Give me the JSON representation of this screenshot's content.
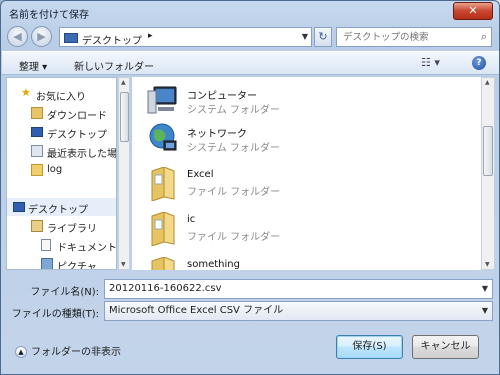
{
  "window": {
    "title": "名前を付けて保存",
    "close_symbol": "✕"
  },
  "address": {
    "location": "デスクトップ",
    "separator": "▸"
  },
  "search": {
    "placeholder": "デスクトップの検索"
  },
  "toolbar": {
    "organize": "整理 ▾",
    "new_folder": "新しいフォルダー"
  },
  "sidebar": {
    "items": [
      {
        "label": "お気に入り",
        "icon": "star-icon"
      },
      {
        "label": "ダウンロード",
        "icon": "download-folder-icon"
      },
      {
        "label": "デスクトップ",
        "icon": "desktop-icon"
      },
      {
        "label": "最近表示した場所",
        "icon": "recent-places-icon"
      },
      {
        "label": "log",
        "icon": "folder-icon"
      },
      {
        "label": "デスクトップ",
        "icon": "desktop-icon",
        "selected": true
      },
      {
        "label": "ライブラリ",
        "icon": "library-icon"
      },
      {
        "label": "ドキュメント",
        "icon": "documents-icon"
      },
      {
        "label": "ピクチャ",
        "icon": "pictures-icon"
      }
    ]
  },
  "files": [
    {
      "name": "コンピューター",
      "type": "システム フォルダー",
      "icon": "computer-icon"
    },
    {
      "name": "ネットワーク",
      "type": "システム フォルダー",
      "icon": "network-globe-icon"
    },
    {
      "name": "Excel",
      "type": "ファイル フォルダー",
      "icon": "folder-icon"
    },
    {
      "name": "ic",
      "type": "ファイル フォルダー",
      "icon": "folder-icon"
    },
    {
      "name": "something",
      "type": "",
      "icon": "folder-icon"
    }
  ],
  "form": {
    "filename_label": "ファイル名(N):",
    "filename_value": "20120116-160622.csv",
    "filetype_label": "ファイルの種類(T):",
    "filetype_value": "Microsoft Office Excel CSV ファイル"
  },
  "footer": {
    "hide_folders": "フォルダーの非表示",
    "save": "保存(S)",
    "cancel": "キャンセル"
  }
}
